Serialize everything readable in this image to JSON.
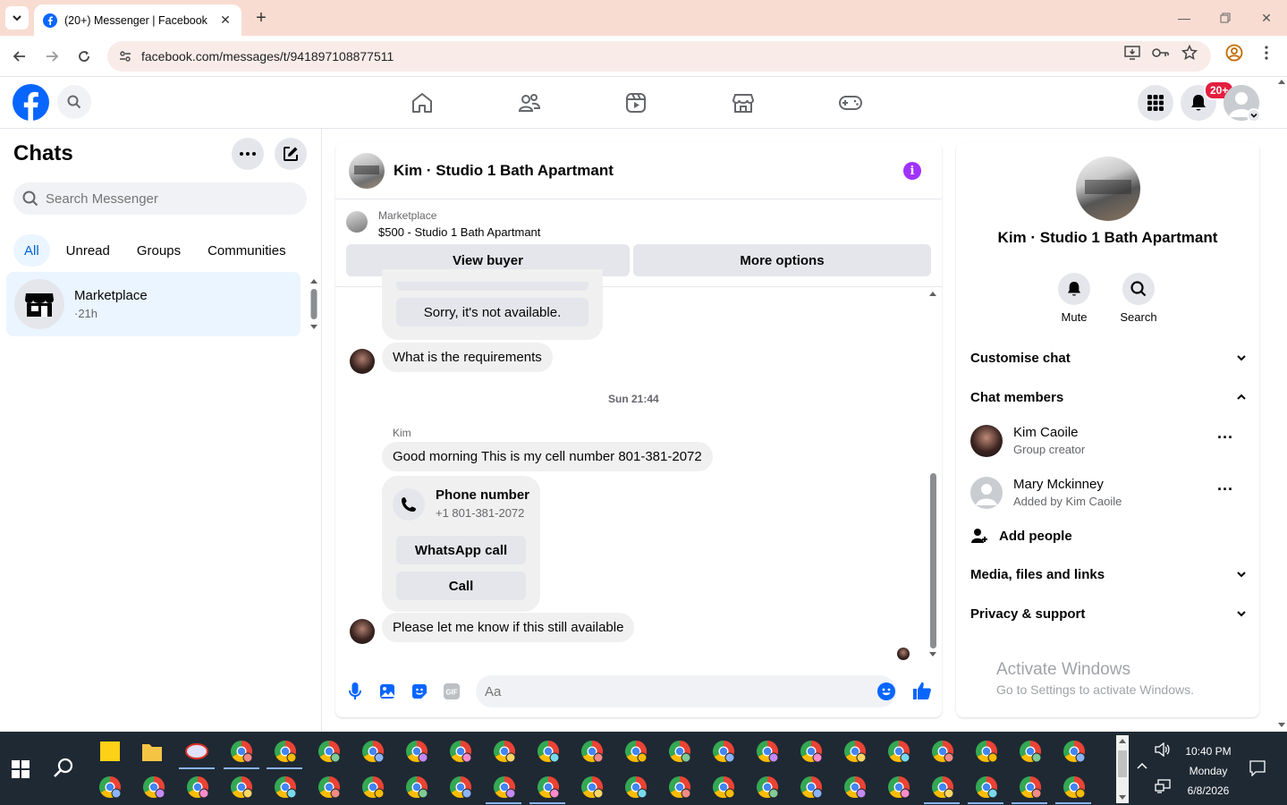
{
  "browser": {
    "tab_title": "(20+) Messenger | Facebook",
    "url": "facebook.com/messages/t/941897108877511",
    "icons": [
      "tab-search-icon",
      "facebook-favicon",
      "close-icon",
      "plus-icon",
      "minimize-icon",
      "restore-icon",
      "close-window-icon",
      "back-icon",
      "forward-icon",
      "reload-icon",
      "site-info-icon",
      "install-app-icon",
      "password-key-icon",
      "bookmark-star-icon",
      "profile-icon",
      "menu-kebab-icon"
    ]
  },
  "fb_header": {
    "notifications_badge": "20+",
    "nav": [
      "home-icon",
      "friends-icon",
      "video-icon",
      "marketplace-icon",
      "gaming-icon"
    ],
    "accent": "#0866ff"
  },
  "chats": {
    "title": "Chats",
    "search_placeholder": "Search Messenger",
    "filters": [
      "All",
      "Unread",
      "Groups",
      "Communities"
    ],
    "active_filter": "All",
    "items": [
      {
        "name": "Marketplace",
        "time": "·21h"
      }
    ]
  },
  "conversation": {
    "title": "Kim · Studio 1 Bath Apartmant",
    "marketplace_label": "Marketplace",
    "listing": "$500 - Studio 1 Bath Apartmant",
    "view_buyer": "View buyer",
    "more_options": "More options",
    "messages": {
      "partial_button": "Sorry, it's not available.",
      "msg1": "What is the requirements",
      "timestamp": "Sun 21:44",
      "sender": "Kim",
      "msg2": "Good morning This is my cell number 801-381-2072",
      "phone_card_title": "Phone number",
      "phone_card_number": "+1 801-381-2072",
      "whatsapp_call": "WhatsApp call",
      "call": "Call",
      "msg3": "Please let me know if this still available"
    },
    "composer_placeholder": "Aa",
    "accent": "#0866ff"
  },
  "info": {
    "name": "Kim · Studio 1 Bath Apartmant",
    "mute": "Mute",
    "search": "Search",
    "customise_chat": "Customise chat",
    "chat_members": "Chat members",
    "members": [
      {
        "name": "Kim Caoile",
        "role": "Group creator"
      },
      {
        "name": "Mary Mckinney",
        "role": "Added by Kim Caoile"
      }
    ],
    "add_people": "Add people",
    "media": "Media, files and links",
    "privacy": "Privacy & support"
  },
  "watermark": {
    "line1": "Activate Windows",
    "line2": "Go to Settings to activate Windows."
  },
  "taskbar": {
    "time": "10:40 PM",
    "day": "Monday",
    "date": "6/8/2026"
  }
}
